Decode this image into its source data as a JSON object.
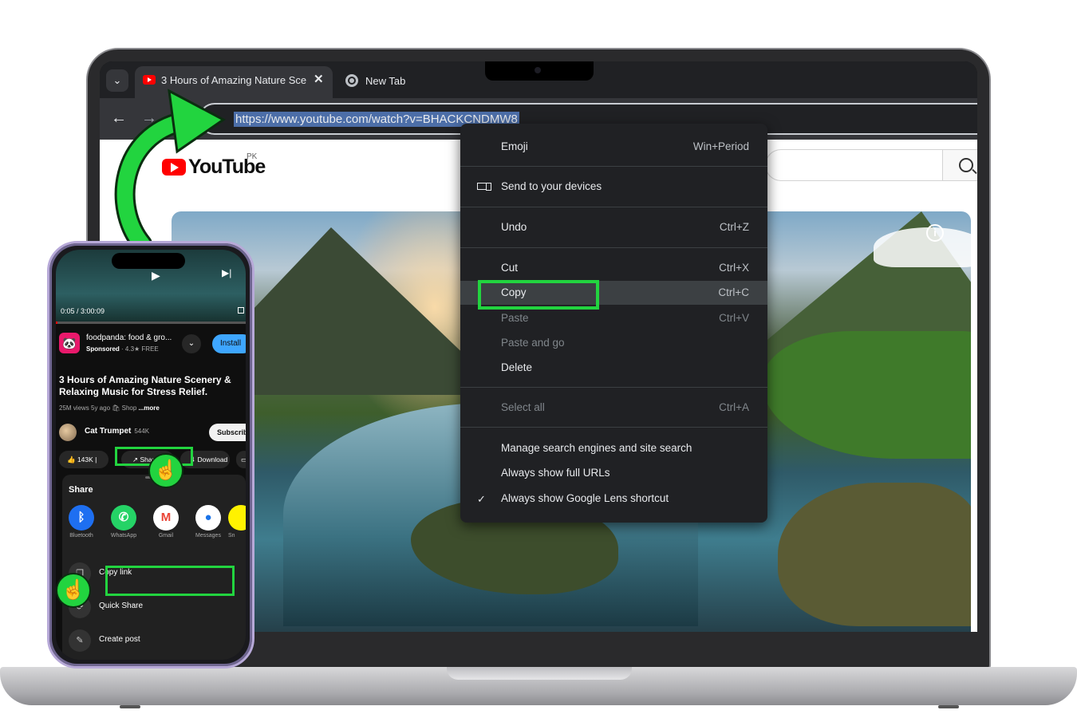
{
  "browser": {
    "tabs": [
      {
        "title": "3 Hours of Amazing Nature Sce",
        "close": "✕",
        "icon": "youtube-icon"
      },
      {
        "title": "New Tab",
        "icon": "chrome-icon"
      }
    ],
    "tab_dropdown": "⌄",
    "nav": {
      "back": "←",
      "forward": "→",
      "reload": "C"
    },
    "url": "https://www.youtube.com/watch?v=BHACKCNDMW8"
  },
  "youtube": {
    "logo_text": "YouTube",
    "country": "PK",
    "search_icon": "search-icon",
    "info": "i"
  },
  "context_menu": {
    "items": [
      {
        "label": "Emoji",
        "shortcut": "Win+Period"
      },
      {
        "label": "Send to your devices",
        "icon": "devices-icon"
      },
      {
        "label": "Undo",
        "shortcut": "Ctrl+Z"
      },
      {
        "label": "Cut",
        "shortcut": "Ctrl+X"
      },
      {
        "label": "Copy",
        "shortcut": "Ctrl+C"
      },
      {
        "label": "Paste",
        "shortcut": "Ctrl+V",
        "disabled": true
      },
      {
        "label": "Paste and go",
        "disabled": true
      },
      {
        "label": "Delete"
      },
      {
        "label": "Select all",
        "shortcut": "Ctrl+A",
        "disabled": true
      },
      {
        "label": "Manage search engines and site search"
      },
      {
        "label": "Always show full URLs"
      },
      {
        "label": "Always show Google Lens shortcut",
        "check": "✓"
      }
    ]
  },
  "phone": {
    "player": {
      "time": "0:05 / 3:00:09",
      "progress": 0.0005
    },
    "ad": {
      "title": "foodpanda: food & gro...",
      "sponsored": "Sponsored",
      "meta": " · 4.3★  FREE",
      "install": "Install",
      "chevron": "⌄"
    },
    "video_title": "3 Hours of Amazing Nature Scenery & Relaxing Music for Stress Relief.",
    "video_meta": "25M views  5y ago  🛍 Shop ",
    "more": "...more",
    "channel": {
      "name": "Cat Trumpet",
      "subs": "544K",
      "subscribe": "Subscribe"
    },
    "actions": {
      "like": "👍  143K  |",
      "share": "↗ Share",
      "download": "⬇ Download",
      "save": "▭"
    },
    "share_sheet": {
      "title": "Share",
      "apps": [
        {
          "label": "Bluetooth",
          "glyph": "ᛒ",
          "color": "#1e6ff1"
        },
        {
          "label": "WhatsApp",
          "glyph": "✆",
          "color": "#25d366"
        },
        {
          "label": "Gmail",
          "glyph": "M",
          "color": "#ffffff"
        },
        {
          "label": "Messages",
          "glyph": "●",
          "color": "#ffffff"
        },
        {
          "label": "Sn",
          "glyph": "",
          "color": "#fff200"
        }
      ],
      "rows": [
        {
          "label": "Copy link",
          "glyph": "❐"
        },
        {
          "label": "Quick Share",
          "glyph": "⟳"
        },
        {
          "label": "Create post",
          "glyph": "✎"
        }
      ]
    }
  },
  "colors": {
    "highlight": "#22d43f",
    "youtube_red": "#ff0000",
    "menu_bg": "#202124"
  }
}
